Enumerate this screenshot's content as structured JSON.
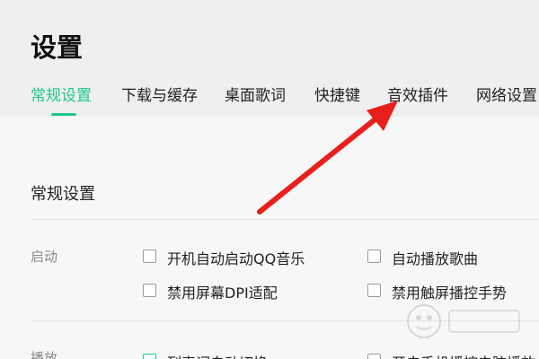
{
  "header": {
    "title": "设置"
  },
  "tabs": [
    {
      "label": "常规设置",
      "active": true
    },
    {
      "label": "下载与缓存",
      "active": false
    },
    {
      "label": "桌面歌词",
      "active": false
    },
    {
      "label": "快捷键",
      "active": false
    },
    {
      "label": "音效插件",
      "active": false
    },
    {
      "label": "网络设置",
      "active": false
    }
  ],
  "main": {
    "section_title": "常规设置",
    "rows": [
      {
        "label": "启动",
        "options": [
          {
            "label": "开机自动启动QQ音乐",
            "checked": false
          },
          {
            "label": "自动播放歌曲",
            "checked": false
          },
          {
            "label": "禁用屏幕DPI适配",
            "checked": false
          },
          {
            "label": "禁用触屏播控手势",
            "checked": false
          }
        ]
      },
      {
        "label": "播放",
        "options": [
          {
            "label": "列表词自动切换",
            "checked": false
          },
          {
            "label": "开启手机播控电脑播放",
            "checked": false
          }
        ]
      }
    ]
  },
  "colors": {
    "accent": "#1ec88a",
    "annotation_arrow": "#e8201c"
  },
  "icons": {
    "annotation": "red-arrow-icon",
    "watermark": "baidu-jingyan-watermark-icon"
  }
}
